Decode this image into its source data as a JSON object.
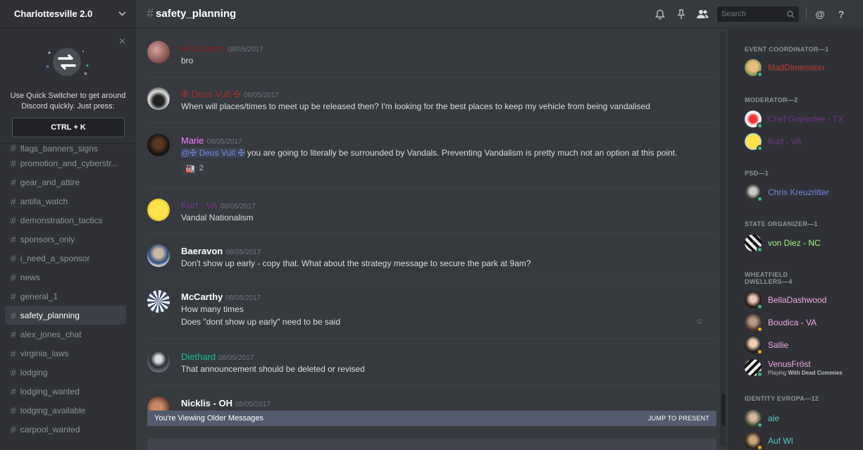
{
  "guild": {
    "name": "Charlottesville 2.0"
  },
  "quick_switcher": {
    "text": "Use Quick Switcher to get around Discord quickly. Just press:",
    "shortcut": "CTRL + K"
  },
  "channels": [
    {
      "name": "flags_banners_signs"
    },
    {
      "name": "promotion_and_cyberstr..."
    },
    {
      "name": "gear_and_attire"
    },
    {
      "name": "antifa_watch"
    },
    {
      "name": "demonstration_tactics"
    },
    {
      "name": "sponsors_only"
    },
    {
      "name": "i_need_a_sponsor"
    },
    {
      "name": "news"
    },
    {
      "name": "general_1"
    },
    {
      "name": "safety_planning"
    },
    {
      "name": "alex_jones_chat"
    },
    {
      "name": "virginia_laws"
    },
    {
      "name": "lodging"
    },
    {
      "name": "lodging_wanted"
    },
    {
      "name": "lodging_available"
    },
    {
      "name": "carpool_wanted"
    }
  ],
  "header": {
    "hash": "#",
    "channel": "safety_planning",
    "search_placeholder": "Search"
  },
  "messages": [
    {
      "author": "b-luccason",
      "color": "#8b1a1a",
      "timestamp": "08/05/2017",
      "lines": [
        "bro"
      ]
    },
    {
      "author": "✠ Deus Vult ✠",
      "color": "#a0302a",
      "timestamp": "08/05/2017",
      "lines": [
        "When will places/times to meet up be released then? I'm looking for the best places to keep my vehicle from being vandalised"
      ]
    },
    {
      "author": "Marie",
      "color": "#f47fff",
      "timestamp": "08/05/2017",
      "mention": "@✠ Deus Vult ✠",
      "lines": [
        " you are going to literally be surrounded by Vandals. Preventing Vandalism is pretty much not an option at this point."
      ],
      "reaction": {
        "emoji": "🏭",
        "count": "2"
      }
    },
    {
      "author": "Kurt - VA",
      "color": "#71368a",
      "timestamp": "08/05/2017",
      "lines": [
        "Vandal Nationalism"
      ]
    },
    {
      "author": "Baeravon",
      "color": "#ffffff",
      "timestamp": "08/05/2017",
      "lines": [
        "Don't show up early - copy that. What about the strategy message to secure the park at 9am?"
      ]
    },
    {
      "author": "McCarthy",
      "color": "#ffffff",
      "timestamp": "08/05/2017",
      "lines": [
        "How many times",
        "Does \"dont show up early\" need to be said"
      ]
    },
    {
      "author": "Diethard",
      "color": "#1abc9c",
      "timestamp": "08/05/2017",
      "lines": [
        "That announcement should be deleted or revised"
      ]
    },
    {
      "author": "Nicklis - OH",
      "color": "#ffffff",
      "timestamp": "08/05/2017",
      "lines": []
    }
  ],
  "older_banner": {
    "text": "You're Viewing Older Messages",
    "jump": "JUMP TO PRESENT"
  },
  "roles": [
    {
      "title": "EVENT COORDINATOR—1",
      "members": [
        {
          "name": "MadDimension",
          "color": "#c0392b",
          "status": "#43b581"
        }
      ]
    },
    {
      "title": "MODERATOR—2",
      "members": [
        {
          "name": "Chef Goyardee - TX",
          "color": "#71368a",
          "status": "#43b581"
        },
        {
          "name": "Kurt - VA",
          "color": "#71368a",
          "status": "#43b581"
        }
      ]
    },
    {
      "title": "PSD—1",
      "members": [
        {
          "name": "Chris Kreuzritter",
          "color": "#7289da",
          "status": "#43b581"
        }
      ]
    },
    {
      "title": "STATE ORGANIZER—1",
      "members": [
        {
          "name": "von Diez - NC",
          "color": "#a4f589",
          "status": "#43b581"
        }
      ]
    },
    {
      "title": "WHEATFIELD DWELLERS—4",
      "members": [
        {
          "name": "BellaDashwood",
          "color": "#f0a8e0",
          "status": "#43b581"
        },
        {
          "name": "Boudica - VA",
          "color": "#f0a8e0",
          "status": "#faa61a"
        },
        {
          "name": "Sallie",
          "color": "#f0a8e0",
          "status": "#faa61a"
        },
        {
          "name": "VenusFröst",
          "color": "#f0a8e0",
          "status": "#43b581",
          "game_prefix": "Playing ",
          "game": "With Dead Commies"
        }
      ]
    },
    {
      "title": "IDENTITY EVROPA—12",
      "members": [
        {
          "name": "ale",
          "color": "#56c7c2",
          "status": "#43b581"
        },
        {
          "name": "Auf WI",
          "color": "#56c7c2",
          "status": "#faa61a"
        }
      ]
    }
  ]
}
